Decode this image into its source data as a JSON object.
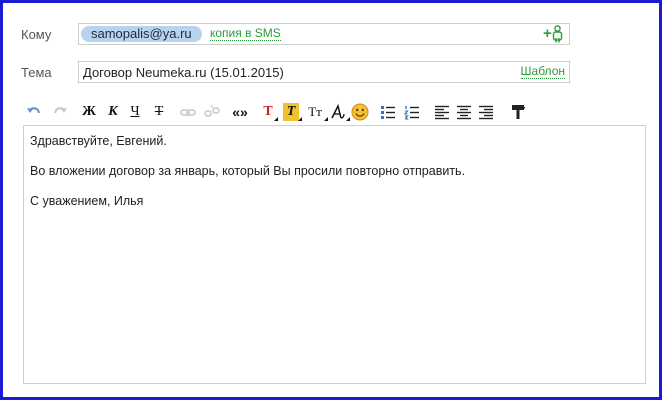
{
  "to": {
    "label": "Кому",
    "recipient": "samopalis@ya.ru",
    "sms_link": "копия в SMS",
    "add_icon": "add-contact-icon"
  },
  "subject": {
    "label": "Тема",
    "value": "Договор Neumeka.ru (15.01.2015)",
    "template_link": "Шаблон"
  },
  "toolbar": {
    "bold": "Ж",
    "italic": "К",
    "underline": "Ч",
    "strike": "Т",
    "quote": "«»",
    "text_color": "Т",
    "bg_color": "Т",
    "font_size": "Тт",
    "icons": [
      "undo-icon",
      "redo-icon",
      "link-icon",
      "unlink-icon",
      "font-icon",
      "smiley-icon",
      "bullet-list-icon",
      "numbered-list-icon",
      "align-left-icon",
      "align-center-icon",
      "align-right-icon",
      "clear-format-icon"
    ]
  },
  "body": {
    "paragraphs": [
      "Здравствуйте, Евгений.",
      "Во вложении договор за январь, который Вы просили повторно отправить.",
      "С уважением, Илья"
    ]
  },
  "colors": {
    "link": "#2e9b3a",
    "chip": "#b9d2f0",
    "frame": "#1a1ad6",
    "text_color": "#d42020",
    "highlight": "#f2c22b"
  }
}
